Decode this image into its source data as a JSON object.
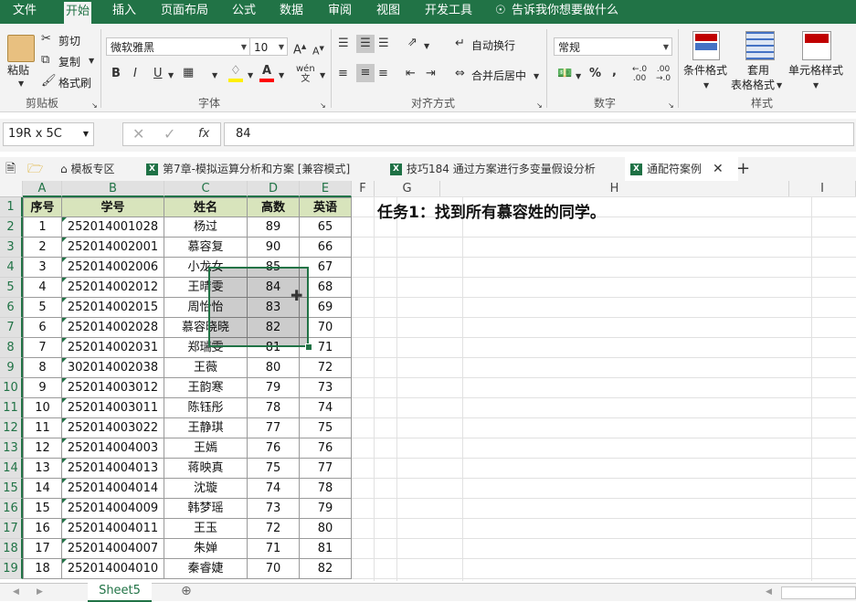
{
  "menu": {
    "file": "文件",
    "tabs": [
      "开始",
      "插入",
      "页面布局",
      "公式",
      "数据",
      "审阅",
      "视图",
      "开发工具"
    ],
    "tell_me": "告诉我你想要做什么"
  },
  "ribbon": {
    "paste": "粘贴",
    "cut": "剪切",
    "copy": "复制",
    "format_painter": "格式刷",
    "clipboard_label": "剪贴板",
    "font_name": "微软雅黑",
    "font_size": "10",
    "bold": "B",
    "italic": "I",
    "underline": "U",
    "font_label": "字体",
    "wrap_text": "自动换行",
    "merge_center": "合并后居中",
    "alignment_label": "对齐方式",
    "number_format": "常规",
    "percent": "%",
    "comma": ",",
    "number_label": "数字",
    "conditional_format": "条件格式",
    "table_format_1": "套用",
    "table_format_2": "表格格式",
    "cell_styles": "单元格样式",
    "styles_label": "样式"
  },
  "formula_bar": {
    "name_box": "19R x 5C",
    "fx": "fx",
    "value": "84"
  },
  "doc_tabs": {
    "template": "模板专区",
    "tab1": "第7章-模拟运算分析和方案 [兼容模式]",
    "tab2": "技巧184 通过方案进行多变量假设分析",
    "tab3": "通配符案例"
  },
  "columns": [
    "A",
    "B",
    "C",
    "D",
    "E",
    "F",
    "G",
    "H",
    "I"
  ],
  "rows": [
    "1",
    "2",
    "3",
    "4",
    "5",
    "6",
    "7",
    "8",
    "9",
    "10",
    "11",
    "12",
    "13",
    "14",
    "15",
    "16",
    "17",
    "18",
    "19"
  ],
  "table": {
    "headers": [
      "序号",
      "学号",
      "姓名",
      "高数",
      "英语"
    ],
    "rows": [
      [
        "1",
        "252014001028",
        "杨过",
        "89",
        "65"
      ],
      [
        "2",
        "252014002001",
        "慕容复",
        "90",
        "66"
      ],
      [
        "3",
        "252014002006",
        "小龙女",
        "85",
        "67"
      ],
      [
        "4",
        "252014002012",
        "王晴雯",
        "84",
        "68"
      ],
      [
        "5",
        "252014002015",
        "周怡怡",
        "83",
        "69"
      ],
      [
        "6",
        "252014002028",
        "慕容晓晓",
        "82",
        "70"
      ],
      [
        "7",
        "252014002031",
        "郑瑞雯",
        "81",
        "71"
      ],
      [
        "8",
        "302014002038",
        "王薇",
        "80",
        "72"
      ],
      [
        "9",
        "252014003012",
        "王韵寒",
        "79",
        "73"
      ],
      [
        "10",
        "252014003011",
        "陈钰彤",
        "78",
        "74"
      ],
      [
        "11",
        "252014003022",
        "王静琪",
        "77",
        "75"
      ],
      [
        "12",
        "252014004003",
        "王嫣",
        "76",
        "76"
      ],
      [
        "13",
        "252014004013",
        "蒋映真",
        "75",
        "77"
      ],
      [
        "14",
        "252014004014",
        "沈璇",
        "74",
        "78"
      ],
      [
        "15",
        "252014004009",
        "韩梦瑶",
        "73",
        "79"
      ],
      [
        "16",
        "252014004011",
        "王玉",
        "72",
        "80"
      ],
      [
        "17",
        "252014004007",
        "朱婵",
        "71",
        "81"
      ],
      [
        "18",
        "252014004010",
        "秦睿婕",
        "70",
        "82"
      ]
    ]
  },
  "task_title": "任务1：找到所有慕容姓的同学。",
  "sheet_tab": "Sheet5",
  "colors": {
    "accent": "#217346",
    "header_fill": "#d8e4bc"
  }
}
